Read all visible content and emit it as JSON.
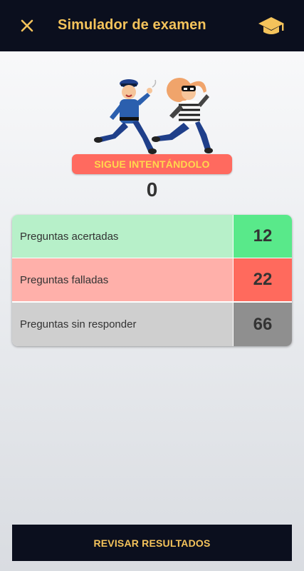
{
  "header": {
    "title": "Simulador de examen",
    "close_icon": "close-icon",
    "action_icon": "graduation-cap-icon"
  },
  "result": {
    "status": "SIGUE INTENTÁNDOLO",
    "score": "0"
  },
  "stats": [
    {
      "label": "Preguntas acertadas",
      "value": "12"
    },
    {
      "label": "Preguntas falladas",
      "value": "22"
    },
    {
      "label": "Preguntas sin responder",
      "value": "66"
    }
  ],
  "footer": {
    "review_label": "REVISAR RESULTADOS"
  },
  "colors": {
    "appbar": "#0b0f1e",
    "accent": "#f4c35b",
    "status_bg": "#ff6a5f",
    "correct": "#59e98a",
    "wrong": "#ff6a5d",
    "unanswered": "#8f8f8f"
  }
}
